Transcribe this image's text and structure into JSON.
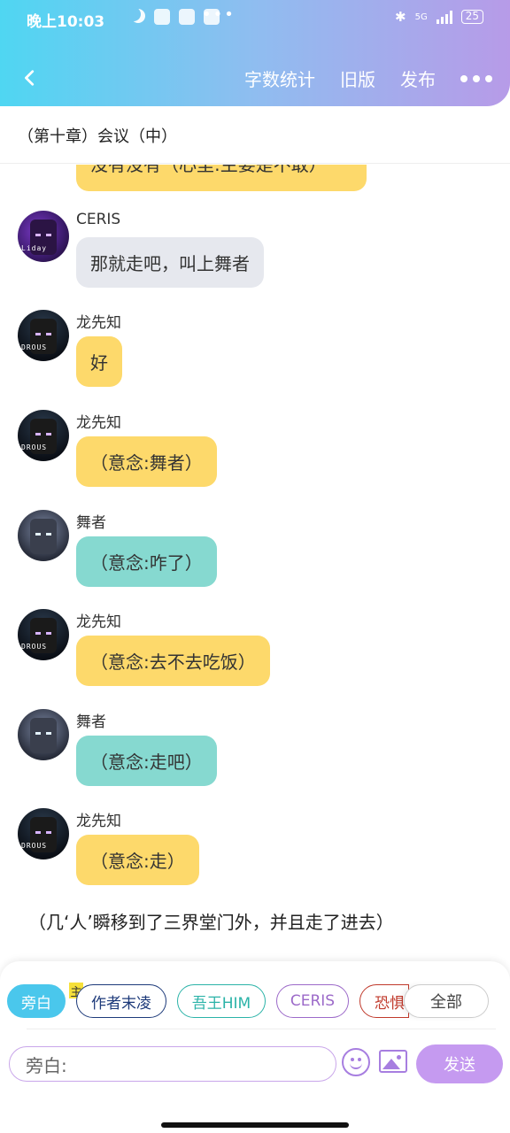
{
  "status_bar": {
    "time": "晚上10:03",
    "battery": "25",
    "network": "5G"
  },
  "nav": {
    "word_count": "字数统计",
    "old_version": "旧版",
    "publish": "发布"
  },
  "chapter_title": "（第十章）会议（中）",
  "messages": [
    {
      "name": "",
      "text": "没有没有（心里:主要是不敢）",
      "color": "yellow"
    },
    {
      "name": "CERIS",
      "text": "那就走吧，叫上舞者",
      "color": "gray"
    },
    {
      "name": "龙先知",
      "text": "好",
      "color": "yellow"
    },
    {
      "name": "龙先知",
      "text": "（意念:舞者）",
      "color": "yellow"
    },
    {
      "name": "舞者",
      "text": "（意念:咋了）",
      "color": "teal"
    },
    {
      "name": "龙先知",
      "text": "（意念:去不去吃饭）",
      "color": "yellow"
    },
    {
      "name": "舞者",
      "text": "（意念:走吧）",
      "color": "teal"
    },
    {
      "name": "龙先知",
      "text": "（意念:走）",
      "color": "yellow"
    }
  ],
  "narration": "（几‘人’瞬移到了三界堂门外，并且走了进去）",
  "roles": [
    {
      "label": "旁白",
      "color": "#4ac7ec"
    },
    {
      "label": "作者末凌",
      "color": "#1d3a7a"
    },
    {
      "label": "吾王HIM",
      "color": "#2bb3a8"
    },
    {
      "label": "CERIS",
      "color": "#9c6ac9"
    },
    {
      "label": "恐惧",
      "color": "#c0392b"
    }
  ],
  "role_badge": "主",
  "all_label": "全部",
  "input_placeholder": "旁白:",
  "send_label": "发送",
  "colors": {
    "yellow_bubble": "#fdd96b",
    "teal_bubble": "#86d9d0",
    "gray_bubble": "#e6e8ee",
    "accent": "#c59af0"
  }
}
